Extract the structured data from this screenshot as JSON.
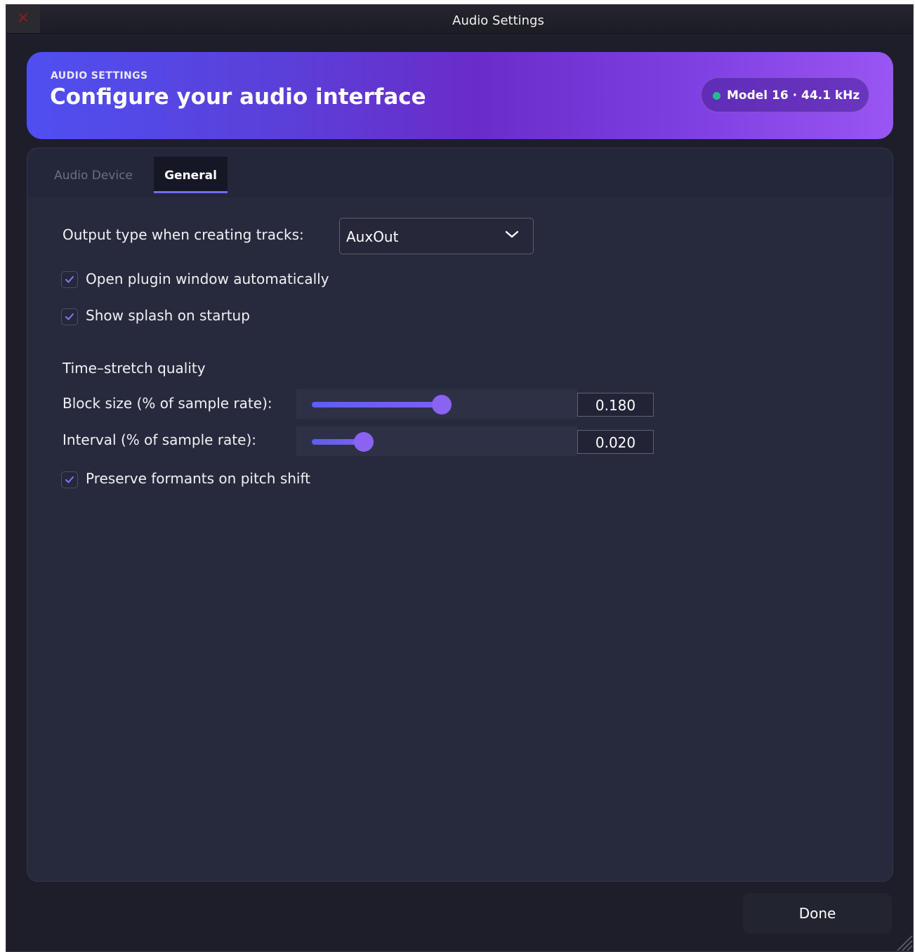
{
  "window": {
    "title": "Audio Settings",
    "close_glyph": "✕"
  },
  "banner": {
    "eyebrow": "AUDIO SETTINGS",
    "title": "Configure your audio interface",
    "device_status": "Model 16 · 44.1 kHz",
    "status_color": "#1ec08a"
  },
  "tabs": [
    {
      "label": "Audio Device",
      "active": false
    },
    {
      "label": "General",
      "active": true
    }
  ],
  "general": {
    "output_type_label": "Output type when creating tracks:",
    "output_type_value": "AuxOut",
    "open_plugin_label": "Open plugin window automatically",
    "open_plugin_checked": true,
    "show_splash_label": "Show splash on startup",
    "show_splash_checked": true,
    "time_stretch_heading": "Time–stretch quality",
    "block_size_label": "Block size (% of sample rate):",
    "block_size_value": "0.180",
    "interval_label": "Interval (% of sample rate):",
    "interval_value": "0.020",
    "preserve_formants_label": "Preserve formants on pitch shift",
    "preserve_formants_checked": true
  },
  "footer": {
    "done_label": "Done"
  },
  "colors": {
    "accent": "#6f6cf5",
    "banner_start": "#4f4ff0",
    "banner_end": "#9a55f2",
    "panel": "#272a3c"
  }
}
